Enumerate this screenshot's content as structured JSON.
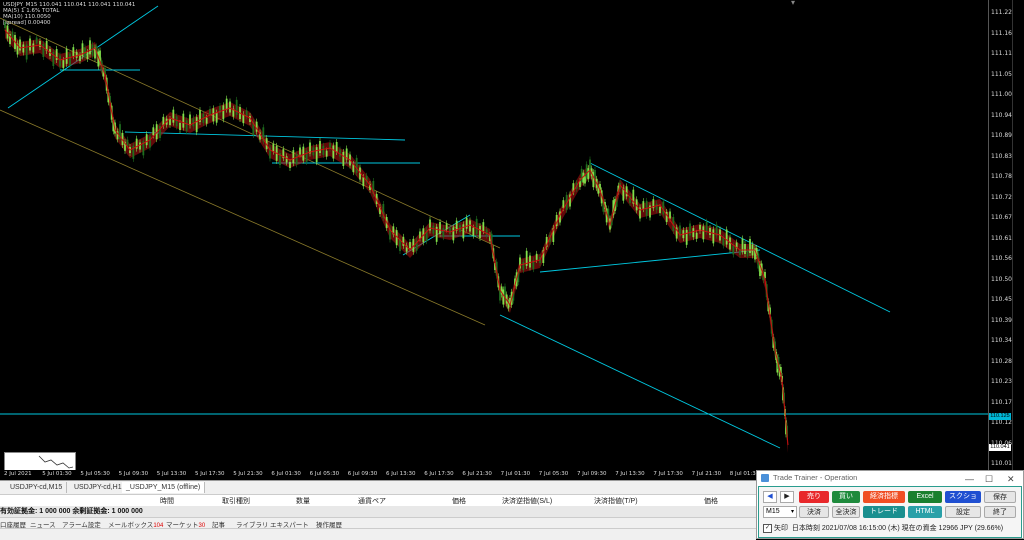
{
  "chart_info": {
    "symbol_line": "USDJPY_M15  110.041 110.041 110.041 110.041",
    "line2": "MA(5) 1 1.6% TOTAL",
    "line3": "MA(10) 110.0050",
    "line4": "[spread] 0.00400"
  },
  "price_axis": [
    "111.220",
    "111.165",
    "111.110",
    "111.055",
    "111.000",
    "110.945",
    "110.890",
    "110.835",
    "110.780",
    "110.725",
    "110.670",
    "110.615",
    "110.560",
    "110.505",
    "110.450",
    "110.395",
    "110.340",
    "110.285",
    "110.230",
    "110.175",
    "110.120",
    "110.065",
    "110.010"
  ],
  "price_tag_horizontal": "110.125",
  "price_tag_current": "110.041",
  "time_axis": [
    "2 Jul 2021",
    "5 Jul 01:30",
    "5 Jul 05:30",
    "5 Jul 09:30",
    "5 Jul 13:30",
    "5 Jul 17:30",
    "5 Jul 21:30",
    "6 Jul 01:30",
    "6 Jul 05:30",
    "6 Jul 09:30",
    "6 Jul 13:30",
    "6 Jul 17:30",
    "6 Jul 21:30",
    "7 Jul 01:30",
    "7 Jul 05:30",
    "7 Jul 09:30",
    "7 Jul 13:30",
    "7 Jul 17:30",
    "7 Jul 21:30",
    "8 Jul 01:30",
    "8 Jul 05:30"
  ],
  "chart_tabs": [
    "USDJPY-cd,M15",
    "USDJPY-cd,H1",
    "_USDJPY_M15 (offline)"
  ],
  "terminal_headers": [
    "時間",
    "取引種別",
    "数量",
    "通貨ペア",
    "価格",
    "決済逆指値(S/L)",
    "決済指値(T/P)",
    "価格"
  ],
  "balance_text": "有効証拠金: 1 000 000  余剰証拠金: 1 000 000",
  "terminal_tabs": [
    {
      "label": "口座履歴",
      "badge": ""
    },
    {
      "label": "ニュース",
      "badge": ""
    },
    {
      "label": "アラーム設定",
      "badge": ""
    },
    {
      "label": "メールボックス",
      "badge": "104"
    },
    {
      "label": "マーケット",
      "badge": "30"
    },
    {
      "label": "記事",
      "badge": ""
    },
    {
      "label": "ライブラリ",
      "badge": ""
    },
    {
      "label": "エキスパート",
      "badge": ""
    },
    {
      "label": "操作履歴",
      "badge": ""
    }
  ],
  "trade_trainer": {
    "title": "Trade Trainer - Operation",
    "buttons_row1": [
      "売り",
      "買い",
      "経済指標",
      "Excel",
      "スクショ",
      "保存"
    ],
    "buttons_row2": [
      "決済",
      "全決済",
      "トレード",
      "HTML",
      "設定",
      "終了"
    ],
    "timeframe": "M15",
    "arrow_label": "矢印",
    "status": "日本時刻 2021/07/08 16:15:00 (木)   現在の資金 12966 JPY (29.66%)"
  },
  "colors": {
    "trendline": "#00c8e0",
    "channel": "#8a7a2a",
    "bull": "#7fe04a",
    "bear": "#1e6e1e",
    "ribbon": "#b01010"
  }
}
